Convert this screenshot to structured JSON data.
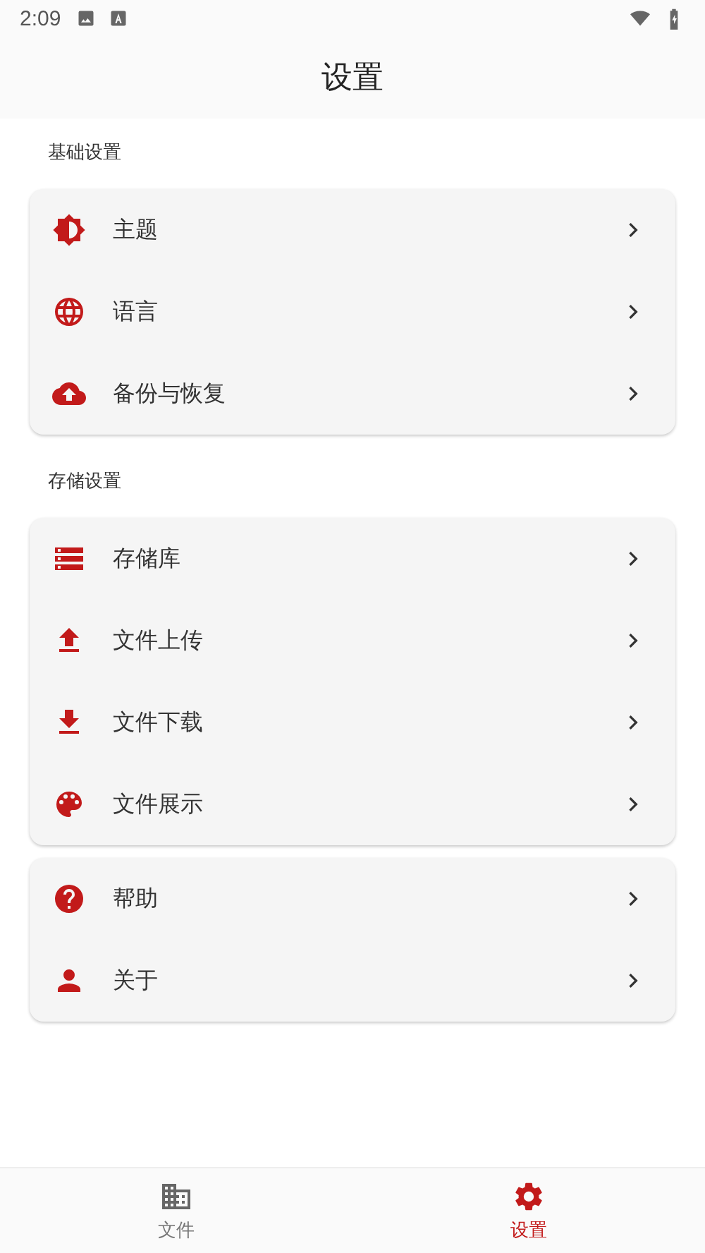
{
  "status_bar": {
    "time": "2:09"
  },
  "app_bar": {
    "title": "设置"
  },
  "groups": [
    {
      "header": "基础设置",
      "items": [
        {
          "kind": "theme",
          "label": "主题"
        },
        {
          "kind": "globe",
          "label": "语言"
        },
        {
          "kind": "backup",
          "label": "备份与恢复"
        }
      ]
    },
    {
      "header": "存储设置",
      "items": [
        {
          "kind": "storage",
          "label": "存储库"
        },
        {
          "kind": "upload",
          "label": "文件上传"
        },
        {
          "kind": "download",
          "label": "文件下载"
        },
        {
          "kind": "palette",
          "label": "文件展示"
        }
      ]
    },
    {
      "items": [
        {
          "kind": "help",
          "label": "帮助"
        },
        {
          "kind": "person",
          "label": "关于"
        }
      ]
    }
  ],
  "bottom_nav": [
    {
      "kind": "files",
      "label": "文件",
      "selected": false
    },
    {
      "kind": "settings",
      "label": "设置",
      "selected": true
    }
  ]
}
